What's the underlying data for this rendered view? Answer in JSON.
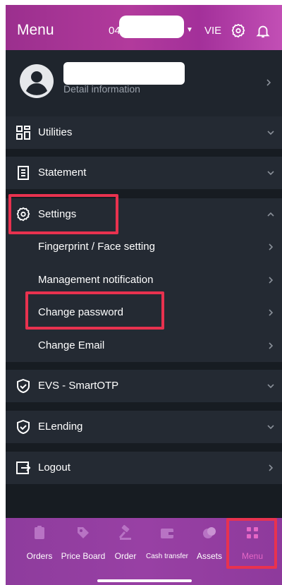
{
  "header": {
    "title": "Menu",
    "account_prefix": "04",
    "language": "VIE"
  },
  "profile": {
    "detail_label": "Detail information"
  },
  "menu": {
    "utilities": "Utilities",
    "statement": "Statement",
    "settings": "Settings",
    "settings_items": [
      "Fingerprint / Face setting",
      "Management notification",
      "Change password",
      "Change Email"
    ],
    "evs": "EVS - SmartOTP",
    "elending": "ELending",
    "logout": "Logout"
  },
  "bottom_nav": {
    "tabs": [
      "Orders",
      "Price Board",
      "Order",
      "Cash transfer",
      "Assets",
      "Menu"
    ],
    "active": "Menu"
  },
  "colors": {
    "accent": "#b23a9c",
    "highlight": "#e8324f",
    "background": "#171c22",
    "row": "#242a33",
    "active_tab": "#e567c6"
  }
}
